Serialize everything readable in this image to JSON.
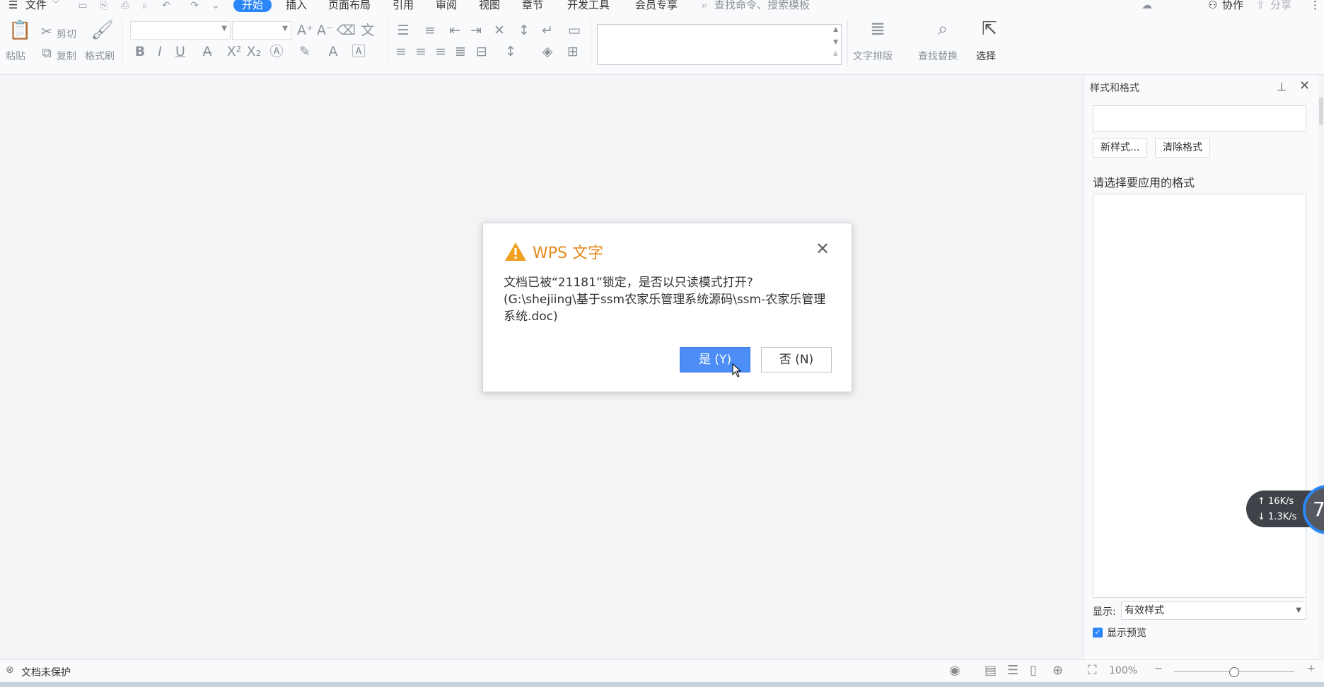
{
  "menubar": {
    "file_label": "文件",
    "tabs": [
      "开始",
      "插入",
      "页面布局",
      "引用",
      "审阅",
      "视图",
      "章节",
      "开发工具",
      "会员专享"
    ],
    "search_placeholder": "查找命令、搜索模板",
    "collab_label": "协作",
    "share_label": "分享"
  },
  "ribbon": {
    "paste": "粘贴",
    "cut": "剪切",
    "copy": "复制",
    "format_painter": "格式刷",
    "text_layout": "文字排版",
    "find_replace": "查找替换",
    "select": "选择",
    "font_name": "",
    "font_size": ""
  },
  "panel": {
    "title": "样式和格式",
    "new_style": "新样式...",
    "clear_format": "清除格式",
    "choose_label": "请选择要应用的格式",
    "show_label": "显示:",
    "show_value": "有效样式",
    "preview_label": "显示预览"
  },
  "dialog": {
    "title": "WPS 文字",
    "message": "文档已被“21181”锁定，是否以只读模式打开?(G:\\shejiing\\基于ssm农家乐管理系统源码\\ssm-农家乐管理系统.doc)",
    "yes_label": "是 (Y)",
    "no_label": "否 (N)"
  },
  "statusbar": {
    "protection": "文档未保护",
    "zoom": "100%"
  },
  "netspeed": {
    "upload": "16K/s",
    "download": "1.3K/s",
    "ring_value": "7"
  },
  "colors": {
    "accent": "#2b86f8",
    "dialog_title": "#e58a1c",
    "primary_button": "#4c8df6"
  }
}
